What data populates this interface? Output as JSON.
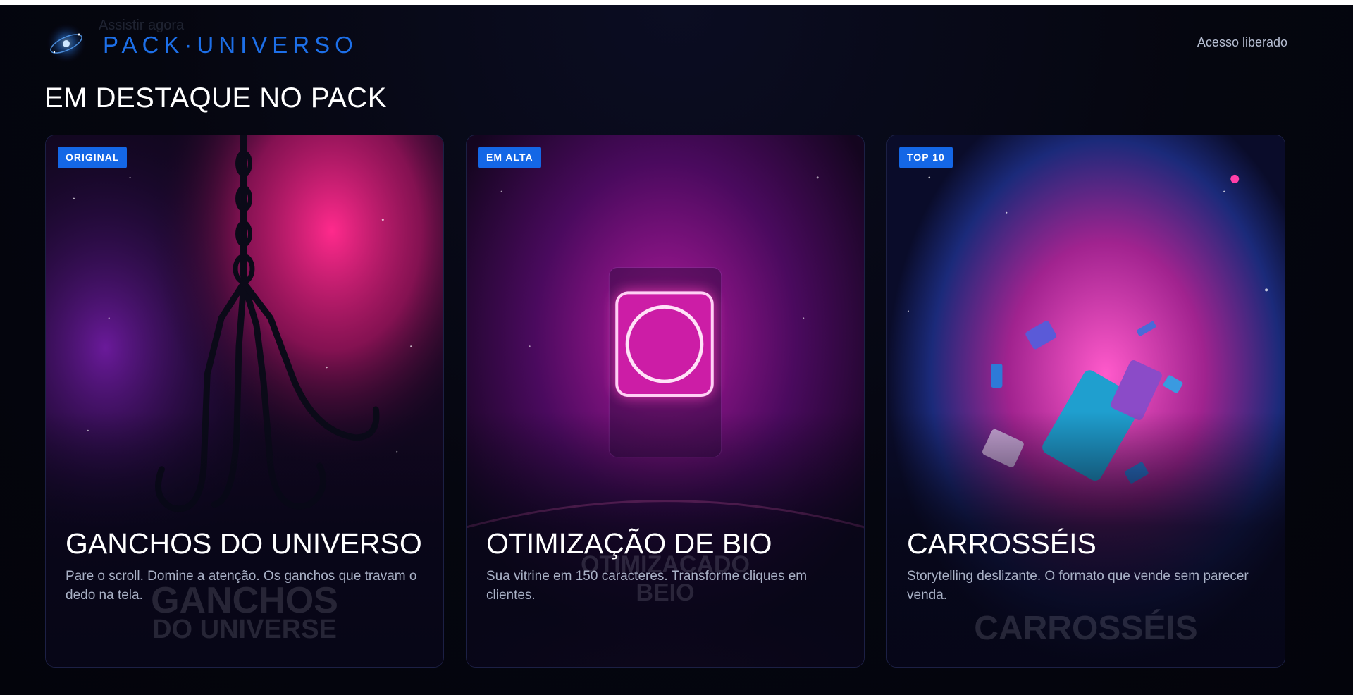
{
  "header": {
    "ghost_label": "Assistir agora",
    "logo_text": "PACK·UNIVERSO",
    "access_label": "Acesso liberado",
    "logo_icon": "galaxy-logo-icon"
  },
  "section": {
    "title": "EM DESTAQUE NO PACK"
  },
  "colors": {
    "accent": "#1467e6",
    "logo": "#1d6fe8",
    "background": "#03040d"
  },
  "cards": [
    {
      "badge": "ORIGINAL",
      "title": "GANCHOS DO UNIVERSO",
      "description": "Pare o scroll. Domine a atenção. Os ganchos que travam o dedo na tela.",
      "watermark_line1": "GANCHOS",
      "watermark_line2": "DO UNIVERSE",
      "art": "hook-chain-nebula-image"
    },
    {
      "badge": "EM ALTA",
      "title": "OTIMIZAÇÃO DE BIO",
      "description": "Sua vitrine em 150 caracteres. Transforme cliques em clientes.",
      "watermark_line1": "OTIMIZACADO",
      "watermark_line2": "BEIO",
      "art": "neon-profile-phone-image"
    },
    {
      "badge": "TOP 10",
      "title": "CARROSSÉIS",
      "description": "Storytelling deslizante. O formato que vende sem parecer venda.",
      "watermark_line1": "CARROSSÉIS",
      "watermark_line2": "",
      "art": "floating-phones-nebula-image"
    }
  ]
}
